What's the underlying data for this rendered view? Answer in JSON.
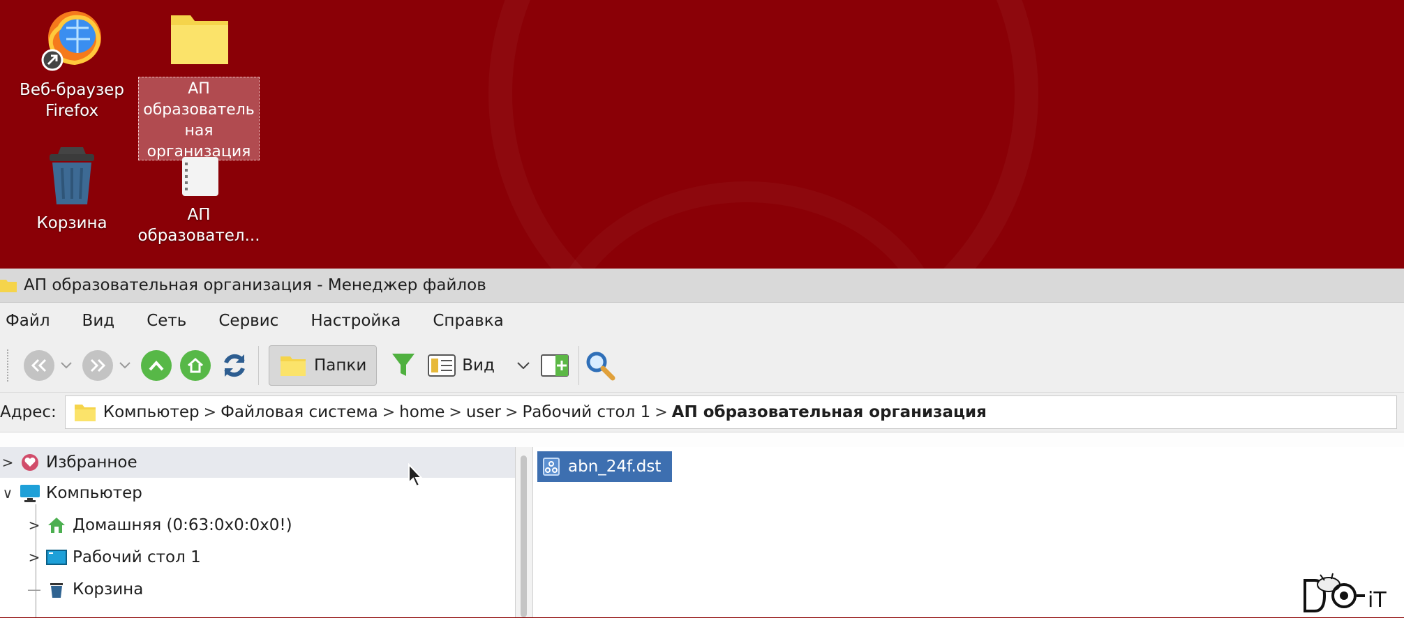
{
  "desktop": {
    "icons": [
      {
        "label_line1": "Веб-браузер",
        "label_line2": "Firefox",
        "icon": "firefox-icon"
      },
      {
        "label_lines": [
          "АП",
          "образователь",
          "ная",
          "организация"
        ],
        "icon": "folder-icon"
      },
      {
        "label": "Корзина",
        "icon": "trash-icon"
      },
      {
        "label_line1": "АП",
        "label_line2": "образовател...",
        "icon": "document-icon"
      }
    ]
  },
  "window": {
    "title": "АП образовательная организация - Менеджер файлов",
    "menu": [
      "Файл",
      "Вид",
      "Сеть",
      "Сервис",
      "Настройка",
      "Справка"
    ],
    "toolbar": {
      "folders_label": "Папки",
      "view_label": "Вид"
    },
    "address": {
      "label": "Адрес:",
      "crumbs": [
        "Компьютер",
        "Файловая система",
        "home",
        "user",
        "Рабочий стол 1",
        "АП образовательная организация"
      ]
    },
    "tree": [
      {
        "label": "Избранное",
        "icon": "heart-icon"
      },
      {
        "label": "Компьютер",
        "icon": "monitor-icon"
      },
      {
        "label": "Домашняя (0:63:0x0:0x0!)",
        "icon": "home-icon"
      },
      {
        "label": "Рабочий стол 1",
        "icon": "desktop-icon"
      },
      {
        "label": "Корзина",
        "icon": "trash-icon"
      }
    ],
    "files": [
      {
        "name": "abn_24f.dst",
        "icon": "file-icon"
      }
    ]
  },
  "watermark": {
    "text": "DO-iT"
  },
  "colors": {
    "desktop_bg": "#8a0006",
    "selection": "#3d6fb0",
    "accent_green": "#57b847"
  }
}
